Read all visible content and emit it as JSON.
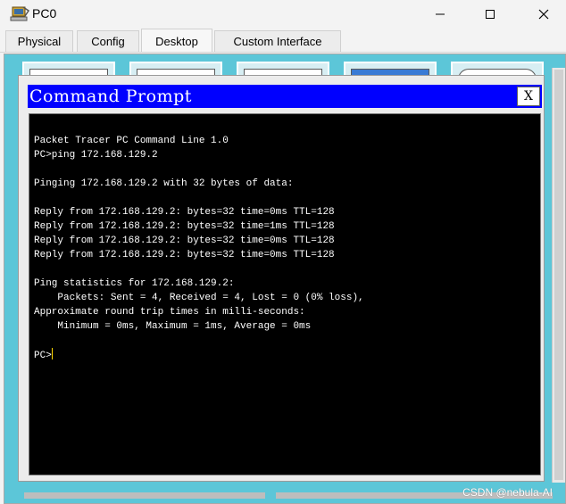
{
  "window": {
    "title": "PC0"
  },
  "tabs": [
    {
      "label": "Physical"
    },
    {
      "label": "Config"
    },
    {
      "label": "Desktop"
    },
    {
      "label": "Custom Interface"
    }
  ],
  "command_prompt": {
    "title": "Command Prompt",
    "close_label": "X",
    "lines": [
      "Packet Tracer PC Command Line 1.0",
      "PC>ping 172.168.129.2",
      "",
      "Pinging 172.168.129.2 with 32 bytes of data:",
      "",
      "Reply from 172.168.129.2: bytes=32 time=0ms TTL=128",
      "Reply from 172.168.129.2: bytes=32 time=1ms TTL=128",
      "Reply from 172.168.129.2: bytes=32 time=0ms TTL=128",
      "Reply from 172.168.129.2: bytes=32 time=0ms TTL=128",
      "",
      "Ping statistics for 172.168.129.2:",
      "    Packets: Sent = 4, Received = 4, Lost = 0 (0% loss),",
      "Approximate round trip times in milli-seconds:",
      "    Minimum = 0ms, Maximum = 1ms, Average = 0ms",
      ""
    ],
    "prompt": "PC>"
  },
  "watermark": "CSDN @nebula-AI",
  "colors": {
    "titlebar": "#0000ff",
    "desktop": "#5cc6d8",
    "terminal_bg": "#000000"
  }
}
